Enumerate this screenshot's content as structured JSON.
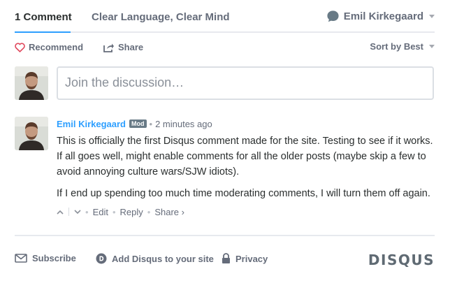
{
  "tabs": {
    "comments": "1 Comment",
    "site": "Clear Language, Clear Mind",
    "user": "Emil Kirkegaard"
  },
  "actions": {
    "recommend": "Recommend",
    "share": "Share",
    "sort": "Sort by Best"
  },
  "composer": {
    "placeholder": "Join the discussion…"
  },
  "comment": {
    "author": "Emil Kirkegaard",
    "badge": "Mod",
    "dot": "•",
    "time": "2 minutes ago",
    "paragraphs": [
      "This is officially the first Disqus comment made for the site. Testing to see if it works. If all goes well, might enable comments for all the older posts (maybe skip a few to avoid annoying culture wars/SJW idiots).",
      "If I end up spending too much time moderating comments, I will turn them off again."
    ],
    "footer": {
      "edit": "Edit",
      "reply": "Reply",
      "share": "Share ›",
      "sep": "•"
    }
  },
  "footer_bar": {
    "subscribe": "Subscribe",
    "add_disqus": "Add Disqus to your site",
    "privacy": "Privacy",
    "logo": "DISQUS"
  },
  "colors": {
    "accent": "#2e9fff",
    "text": "#2a2e2e",
    "muted": "#656c7a",
    "recommend_heart": "#e0475c"
  }
}
